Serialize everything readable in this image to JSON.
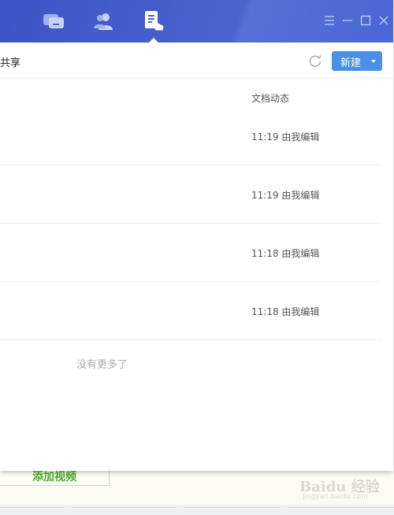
{
  "titlebar": {
    "tabs": [
      {
        "name": "messages",
        "icon": "chat-icon"
      },
      {
        "name": "contacts",
        "icon": "contacts-icon"
      },
      {
        "name": "documents",
        "icon": "cloud-document-icon",
        "active": true
      }
    ],
    "window_controls": [
      "menu-icon",
      "minimize-icon",
      "maximize-icon",
      "close-icon"
    ]
  },
  "toolbar": {
    "title_partial": "共享",
    "refresh_icon": "refresh-icon",
    "new_button_label": "新建"
  },
  "list": {
    "column_header": "文档动态",
    "rows": [
      {
        "activity": "11:19 由我编辑"
      },
      {
        "activity": "11:19 由我编辑"
      },
      {
        "activity": "11:18 由我编辑"
      },
      {
        "activity": "11:18 由我编辑"
      }
    ],
    "footer": "没有更多了"
  },
  "background": {
    "add_video_label": "添加视频"
  },
  "watermark": {
    "line1": "Baidu 经验",
    "line2": "jingyan.baidu.com"
  },
  "colors": {
    "titlebar": "#4a63cf",
    "accent": "#4a90e8",
    "add_video": "#4caa2a"
  }
}
